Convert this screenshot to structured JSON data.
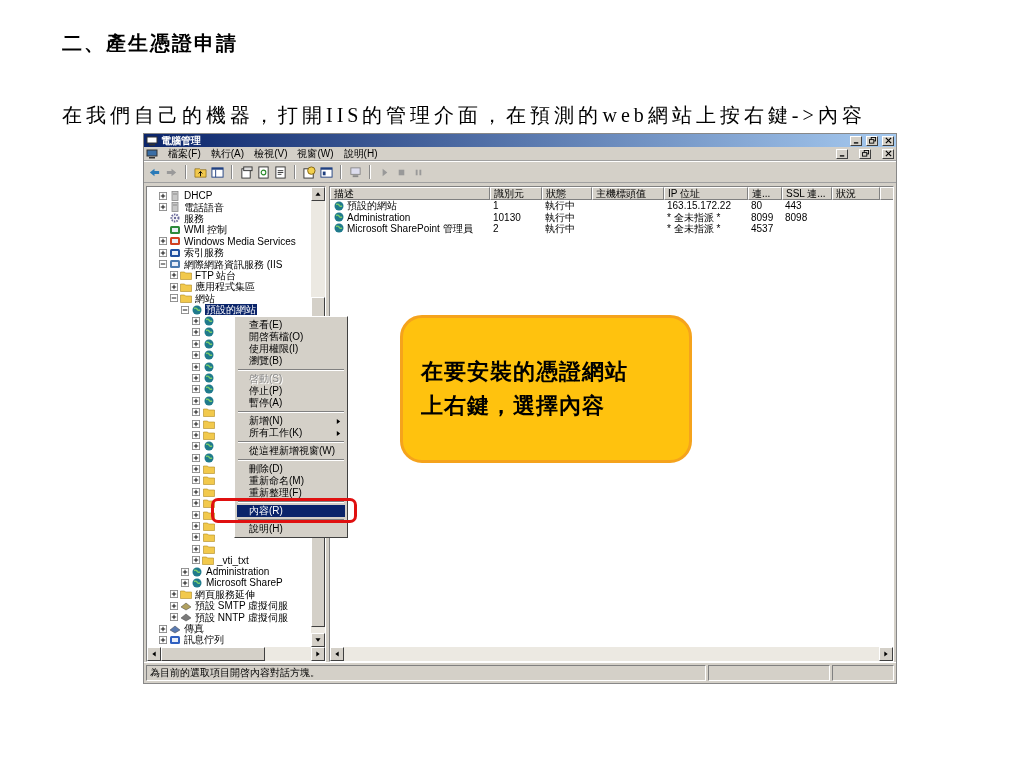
{
  "slide": {
    "heading": "二、產生憑證申請",
    "instruction": "在我們自己的機器，打開IIS的管理介面，在預測的web網站上按右鍵->內容"
  },
  "window": {
    "title": "電腦管理",
    "menu": [
      {
        "label": "檔案(F)"
      },
      {
        "label": "執行(A)"
      },
      {
        "label": "檢視(V)"
      },
      {
        "label": "視窗(W)"
      },
      {
        "label": "說明(H)"
      }
    ],
    "tree": [
      {
        "label": "DHCP",
        "kind": "server",
        "expanded": false,
        "selected": false
      },
      {
        "label": "電話語音",
        "kind": "server",
        "expanded": false,
        "selected": false
      },
      {
        "label": "服務",
        "kind": "gear",
        "selected": false
      },
      {
        "label": "WMI 控制",
        "kind": "wmi",
        "selected": false
      },
      {
        "label": "Windows Media Services",
        "kind": "media",
        "expanded": false,
        "selected": false
      },
      {
        "label": "索引服務",
        "kind": "index",
        "expanded": false,
        "selected": false
      },
      {
        "label": "網際網路資訊服務 (IIS",
        "kind": "iis",
        "expanded": true,
        "selected": false,
        "children": [
          {
            "label": "FTP 站台",
            "kind": "folder",
            "expanded": false,
            "selected": false
          },
          {
            "label": "應用程式集區",
            "kind": "folder",
            "expanded": false,
            "selected": false
          },
          {
            "label": "網站",
            "kind": "folder",
            "expanded": true,
            "selected": false,
            "children": [
              {
                "label": "預設的網站",
                "kind": "globe",
                "expanded": true,
                "selected": true,
                "children": [
                  {
                    "kind": "globe",
                    "expanded": false,
                    "selected": false
                  },
                  {
                    "kind": "globe",
                    "expanded": false,
                    "selected": false
                  },
                  {
                    "kind": "globe",
                    "expanded": false,
                    "selected": false
                  },
                  {
                    "kind": "globe",
                    "expanded": false,
                    "selected": false
                  },
                  {
                    "kind": "globe",
                    "expanded": false,
                    "selected": false
                  },
                  {
                    "kind": "globe",
                    "expanded": false,
                    "selected": false
                  },
                  {
                    "kind": "globe",
                    "expanded": false,
                    "selected": false
                  },
                  {
                    "kind": "globe",
                    "expanded": false,
                    "selected": false
                  },
                  {
                    "kind": "folder",
                    "expanded": false,
                    "selected": false
                  },
                  {
                    "kind": "folder",
                    "expanded": false,
                    "selected": false
                  },
                  {
                    "kind": "folder",
                    "expanded": false,
                    "selected": false
                  },
                  {
                    "kind": "globe",
                    "expanded": false,
                    "selected": false
                  },
                  {
                    "kind": "globe",
                    "expanded": false,
                    "selected": false
                  },
                  {
                    "kind": "folder",
                    "expanded": false,
                    "selected": false
                  },
                  {
                    "kind": "folder",
                    "expanded": false,
                    "selected": false
                  },
                  {
                    "kind": "folder",
                    "expanded": false,
                    "selected": false
                  },
                  {
                    "kind": "folder",
                    "expanded": false,
                    "selected": false
                  },
                  {
                    "kind": "folder",
                    "expanded": false,
                    "selected": false
                  },
                  {
                    "kind": "folder",
                    "expanded": false,
                    "selected": false
                  },
                  {
                    "kind": "folder",
                    "expanded": false,
                    "selected": false
                  },
                  {
                    "kind": "folder",
                    "expanded": false,
                    "selected": false
                  },
                  {
                    "label": "_vti_txt",
                    "kind": "folder",
                    "expanded": false,
                    "selected": false
                  }
                ]
              },
              {
                "label": "Administration",
                "kind": "globe",
                "expanded": false,
                "selected": false
              },
              {
                "label": "Microsoft ShareP",
                "kind": "globe",
                "expanded": false,
                "selected": false
              }
            ]
          },
          {
            "label": "網頁服務延伸",
            "kind": "folder",
            "expanded": false,
            "selected": false
          },
          {
            "label": "預設 SMTP 虛擬伺服",
            "kind": "smtp",
            "expanded": false,
            "selected": false
          },
          {
            "label": "預設 NNTP 虛擬伺服",
            "kind": "nntp",
            "expanded": false,
            "selected": false
          }
        ]
      },
      {
        "label": "傳真",
        "kind": "fax",
        "expanded": false,
        "selected": false
      },
      {
        "label": "訊息佇列",
        "kind": "queue",
        "expanded": false,
        "selected": false
      }
    ],
    "context_menu": [
      {
        "kind": "item",
        "label": "查看(E)",
        "disabled": false,
        "submenu": false,
        "selected": false
      },
      {
        "kind": "item",
        "label": "開啓舊檔(O)",
        "disabled": false,
        "submenu": false,
        "selected": false
      },
      {
        "kind": "item",
        "label": "使用權限(I)",
        "disabled": false,
        "submenu": false,
        "selected": false
      },
      {
        "kind": "item",
        "label": "瀏覽(B)",
        "disabled": false,
        "submenu": false,
        "selected": false
      },
      {
        "kind": "separator"
      },
      {
        "kind": "item",
        "label": "啓動(S)",
        "disabled": true,
        "submenu": false,
        "selected": false
      },
      {
        "kind": "item",
        "label": "停止(P)",
        "disabled": false,
        "submenu": false,
        "selected": false
      },
      {
        "kind": "item",
        "label": "暫停(A)",
        "disabled": false,
        "submenu": false,
        "selected": false
      },
      {
        "kind": "separator"
      },
      {
        "kind": "item",
        "label": "新增(N)",
        "disabled": false,
        "submenu": true,
        "selected": false
      },
      {
        "kind": "item",
        "label": "所有工作(K)",
        "disabled": false,
        "submenu": true,
        "selected": false
      },
      {
        "kind": "separator"
      },
      {
        "kind": "item",
        "label": "從這裡新增視窗(W)",
        "disabled": false,
        "submenu": false,
        "selected": false
      },
      {
        "kind": "separator"
      },
      {
        "kind": "item",
        "label": "刪除(D)",
        "disabled": false,
        "submenu": false,
        "selected": false
      },
      {
        "kind": "item",
        "label": "重新命名(M)",
        "disabled": false,
        "submenu": false,
        "selected": false
      },
      {
        "kind": "item",
        "label": "重新整理(F)",
        "disabled": false,
        "submenu": false,
        "selected": false
      },
      {
        "kind": "separator"
      },
      {
        "kind": "item",
        "label": "內容(R)",
        "disabled": false,
        "submenu": false,
        "selected": true
      },
      {
        "kind": "separator"
      },
      {
        "kind": "item",
        "label": "說明(H)",
        "disabled": false,
        "submenu": false,
        "selected": false
      }
    ],
    "list": {
      "columns": [
        "描述",
        "識別元",
        "狀態",
        "主機標頭值",
        "IP 位址",
        "連...",
        "SSL 連...",
        "狀況"
      ],
      "rows": [
        [
          "預設的網站",
          "1",
          "執行中",
          "",
          "163.15.172.22",
          "80",
          "443",
          ""
        ],
        [
          "Administration",
          "10130",
          "執行中",
          "",
          "* 全未指派 *",
          "8099",
          "8098",
          ""
        ],
        [
          "Microsoft SharePoint 管理員",
          "2",
          "執行中",
          "",
          "* 全未指派 *",
          "4537",
          "",
          ""
        ]
      ]
    },
    "status_bar": "為目前的選取項目開啓內容對話方塊。"
  },
  "callout": {
    "lines": [
      "在要安裝的憑證網站",
      "上右鍵，選擇內容"
    ]
  }
}
